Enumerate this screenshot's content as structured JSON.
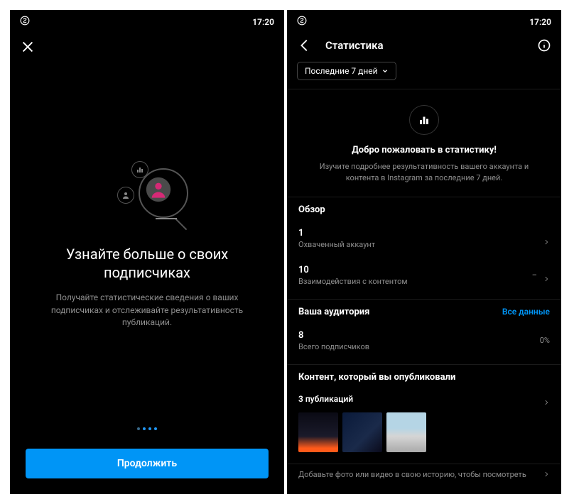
{
  "status": {
    "time": "17:20"
  },
  "left": {
    "title": "Узнайте больше о своих подписчиках",
    "subtitle": "Получайте статистические сведения о ваших подписчиках и отслеживайте результативность публикаций.",
    "cta": "Продолжить"
  },
  "right": {
    "title": "Статистика",
    "range": "Последние 7 дней",
    "welcome_title": "Добро пожаловать в статистику!",
    "welcome_sub": "Изучите подробнее результативность вашего аккаунта и контента в Instagram за последние 7 дней.",
    "overview": {
      "title": "Обзор",
      "reach_value": "1",
      "reach_label": "Охваченный аккаунт",
      "inter_value": "10",
      "inter_label": "Взаимодействия с контентом",
      "inter_trend": "–"
    },
    "audience": {
      "title": "Ваша аудитория",
      "link": "Все данные",
      "foll_value": "8",
      "foll_label": "Всего подписчиков",
      "foll_trend": "0%"
    },
    "content": {
      "title": "Контент, который вы опубликовали",
      "pub_label": "3 публикаций",
      "story_hint": "Добавьте фото или видео в свою историю, чтобы посмотреть"
    }
  }
}
